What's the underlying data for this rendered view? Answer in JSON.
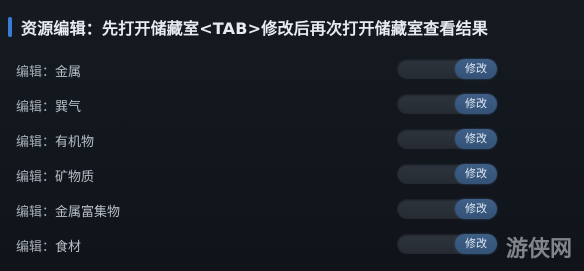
{
  "header": {
    "title": "资源编辑：先打开储藏室<TAB>修改后再次打开储藏室查看结果"
  },
  "rows": [
    {
      "prefix": "编辑：",
      "name": "金属",
      "button": "修改"
    },
    {
      "prefix": "编辑：",
      "name": "巽气",
      "button": "修改"
    },
    {
      "prefix": "编辑：",
      "name": "有机物",
      "button": "修改"
    },
    {
      "prefix": "编辑：",
      "name": "矿物质",
      "button": "修改"
    },
    {
      "prefix": "编辑：",
      "name": "金属富集物",
      "button": "修改"
    },
    {
      "prefix": "编辑：",
      "name": "食材",
      "button": "修改"
    }
  ],
  "watermark": "游侠网",
  "colors": {
    "accent": "#3a7bd5",
    "button": "#3f5f87",
    "background": "#12161c"
  }
}
